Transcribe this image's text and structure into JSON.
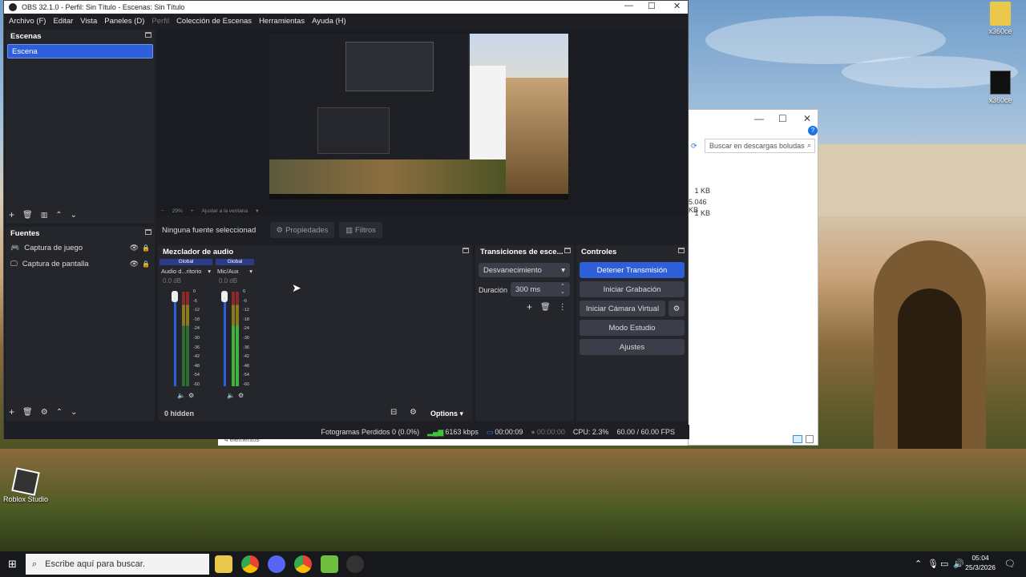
{
  "window": {
    "title": "OBS 32.1.0 - Perfil: Sin Título - Escenas: Sin Título",
    "minimize": "—",
    "maximize": "☐",
    "close": "✕"
  },
  "menu": [
    "Archivo (F)",
    "Editar",
    "Vista",
    "Paneles (D)",
    "Perfil",
    "Colección de Escenas",
    "Herramientas",
    "Ayuda (H)"
  ],
  "scenes": {
    "title": "Escenas",
    "items": [
      "Escena"
    ]
  },
  "sources": {
    "title": "Fuentes",
    "items": [
      {
        "label": "Captura de juego",
        "icon": "gamepad-icon"
      },
      {
        "label": "Captura de pantalla",
        "icon": "monitor-icon"
      }
    ]
  },
  "preview": {
    "zoom": "29%",
    "fit": "Ajustar a la ventana"
  },
  "source_bar": {
    "none_selected": "Ninguna fuente seleccionad",
    "properties": "Propiedades",
    "filters": "Filtros"
  },
  "mixer": {
    "title": "Mezclador de audio",
    "channels": [
      {
        "tag": "Global",
        "name": "Audio d...ritorio",
        "db": "0.0 dB"
      },
      {
        "tag": "Global",
        "name": "Mic/Aux",
        "db": "0.0 dB"
      }
    ],
    "ticks": [
      "0",
      "-6",
      "-12",
      "-18",
      "-24",
      "-30",
      "-36",
      "-42",
      "-48",
      "-54",
      "-60"
    ],
    "hidden": "0 hidden",
    "options": "Options"
  },
  "transitions": {
    "title": "Transiciones de esce...",
    "type": "Desvanecimiento",
    "duration_label": "Duración",
    "duration_value": "300 ms"
  },
  "controls": {
    "title": "Controles",
    "stop_stream": "Detener Transmisión",
    "start_recording": "Iniciar Grabación",
    "start_virtual_cam": "Iniciar Cámara Virtual",
    "studio_mode": "Modo Estudio",
    "settings": "Ajustes"
  },
  "status": {
    "dropped": "Fotogramas Perdidos 0 (0.0%)",
    "bitrate": "6163 kbps",
    "stream_time": "00:00:09",
    "rec_time": "00:00:00",
    "cpu": "CPU: 2.3%",
    "fps": "60.00 / 60.00 FPS"
  },
  "explorer": {
    "search_placeholder": "Buscar en descargas boludas",
    "sizes": [
      "1 KB",
      "5.046 KB",
      "1 KB"
    ],
    "footer": "4 elementos"
  },
  "desktop": {
    "icons": [
      {
        "label": "x360ce"
      },
      {
        "label": "x360ce"
      },
      {
        "label": "Roblox Studio"
      }
    ]
  },
  "taskbar": {
    "search_placeholder": "Escribe aquí para buscar.",
    "time": "05:04",
    "date": "25/3/2026"
  }
}
